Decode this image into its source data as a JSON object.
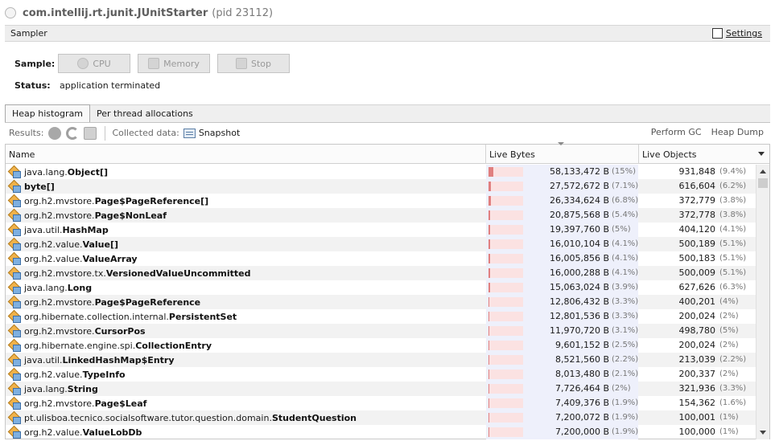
{
  "window": {
    "process_name": "com.intellij.rt.junit.JUnitStarter",
    "pid_text": "(pid 23112)"
  },
  "sampler": {
    "title": "Sampler",
    "settings_label": "Settings",
    "settings_checked": false,
    "sample_label": "Sample:",
    "cpu_label": "CPU",
    "memory_label": "Memory",
    "stop_label": "Stop",
    "status_label": "Status:",
    "status_value": "application terminated"
  },
  "tabs": [
    {
      "label": "Heap histogram",
      "active": true
    },
    {
      "label": "Per thread allocations",
      "active": false
    }
  ],
  "toolbar": {
    "results_label": "Results:",
    "collected_label": "Collected data:",
    "snapshot_label": "Snapshot",
    "perform_gc_label": "Perform GC",
    "heap_dump_label": "Heap Dump"
  },
  "table": {
    "columns": {
      "name": "Name",
      "live_bytes": "Live Bytes",
      "live_objects": "Live Objects"
    },
    "rows": [
      {
        "pkg": "java.lang.",
        "cls": "Object[]",
        "bytes": "58,133,472 B",
        "bytes_pct": "(15%)",
        "bytes_frac": 0.15,
        "objects": "931,848",
        "objects_pct": "(9.4%)"
      },
      {
        "pkg": "",
        "cls": "byte[]",
        "bytes": "27,572,672 B",
        "bytes_pct": "(7.1%)",
        "bytes_frac": 0.071,
        "objects": "616,604",
        "objects_pct": "(6.2%)"
      },
      {
        "pkg": "org.h2.mvstore.",
        "cls": "Page$PageReference[]",
        "bytes": "26,334,624 B",
        "bytes_pct": "(6.8%)",
        "bytes_frac": 0.068,
        "objects": "372,779",
        "objects_pct": "(3.8%)"
      },
      {
        "pkg": "org.h2.mvstore.",
        "cls": "Page$NonLeaf",
        "bytes": "20,875,568 B",
        "bytes_pct": "(5.4%)",
        "bytes_frac": 0.054,
        "objects": "372,778",
        "objects_pct": "(3.8%)"
      },
      {
        "pkg": "java.util.",
        "cls": "HashMap",
        "bytes": "19,397,760 B",
        "bytes_pct": "(5%)",
        "bytes_frac": 0.05,
        "objects": "404,120",
        "objects_pct": "(4.1%)"
      },
      {
        "pkg": "org.h2.value.",
        "cls": "Value[]",
        "bytes": "16,010,104 B",
        "bytes_pct": "(4.1%)",
        "bytes_frac": 0.041,
        "objects": "500,189",
        "objects_pct": "(5.1%)"
      },
      {
        "pkg": "org.h2.value.",
        "cls": "ValueArray",
        "bytes": "16,005,856 B",
        "bytes_pct": "(4.1%)",
        "bytes_frac": 0.041,
        "objects": "500,183",
        "objects_pct": "(5.1%)"
      },
      {
        "pkg": "org.h2.mvstore.tx.",
        "cls": "VersionedValueUncommitted",
        "bytes": "16,000,288 B",
        "bytes_pct": "(4.1%)",
        "bytes_frac": 0.041,
        "objects": "500,009",
        "objects_pct": "(5.1%)"
      },
      {
        "pkg": "java.lang.",
        "cls": "Long",
        "bytes": "15,063,024 B",
        "bytes_pct": "(3.9%)",
        "bytes_frac": 0.039,
        "objects": "627,626",
        "objects_pct": "(6.3%)"
      },
      {
        "pkg": "org.h2.mvstore.",
        "cls": "Page$PageReference",
        "bytes": "12,806,432 B",
        "bytes_pct": "(3.3%)",
        "bytes_frac": 0.033,
        "objects": "400,201",
        "objects_pct": "(4%)"
      },
      {
        "pkg": "org.hibernate.collection.internal.",
        "cls": "PersistentSet",
        "bytes": "12,801,536 B",
        "bytes_pct": "(3.3%)",
        "bytes_frac": 0.033,
        "objects": "200,024",
        "objects_pct": "(2%)"
      },
      {
        "pkg": "org.h2.mvstore.",
        "cls": "CursorPos",
        "bytes": "11,970,720 B",
        "bytes_pct": "(3.1%)",
        "bytes_frac": 0.031,
        "objects": "498,780",
        "objects_pct": "(5%)"
      },
      {
        "pkg": "org.hibernate.engine.spi.",
        "cls": "CollectionEntry",
        "bytes": "9,601,152 B",
        "bytes_pct": "(2.5%)",
        "bytes_frac": 0.025,
        "objects": "200,024",
        "objects_pct": "(2%)"
      },
      {
        "pkg": "java.util.",
        "cls": "LinkedHashMap$Entry",
        "bytes": "8,521,560 B",
        "bytes_pct": "(2.2%)",
        "bytes_frac": 0.022,
        "objects": "213,039",
        "objects_pct": "(2.2%)"
      },
      {
        "pkg": "org.h2.value.",
        "cls": "TypeInfo",
        "bytes": "8,013,480 B",
        "bytes_pct": "(2.1%)",
        "bytes_frac": 0.021,
        "objects": "200,337",
        "objects_pct": "(2%)"
      },
      {
        "pkg": "java.lang.",
        "cls": "String",
        "bytes": "7,726,464 B",
        "bytes_pct": "(2%)",
        "bytes_frac": 0.02,
        "objects": "321,936",
        "objects_pct": "(3.3%)"
      },
      {
        "pkg": "org.h2.mvstore.",
        "cls": "Page$Leaf",
        "bytes": "7,409,376 B",
        "bytes_pct": "(1.9%)",
        "bytes_frac": 0.019,
        "objects": "154,362",
        "objects_pct": "(1.6%)"
      },
      {
        "pkg": "pt.ulisboa.tecnico.socialsoftware.tutor.question.domain.",
        "cls": "StudentQuestion",
        "bytes": "7,200,072 B",
        "bytes_pct": "(1.9%)",
        "bytes_frac": 0.019,
        "objects": "100,001",
        "objects_pct": "(1%)"
      },
      {
        "pkg": "org.h2.value.",
        "cls": "ValueLobDb",
        "bytes": "7,200,000 B",
        "bytes_pct": "(1.9%)",
        "bytes_frac": 0.019,
        "objects": "100,000",
        "objects_pct": "(1%)"
      }
    ]
  }
}
